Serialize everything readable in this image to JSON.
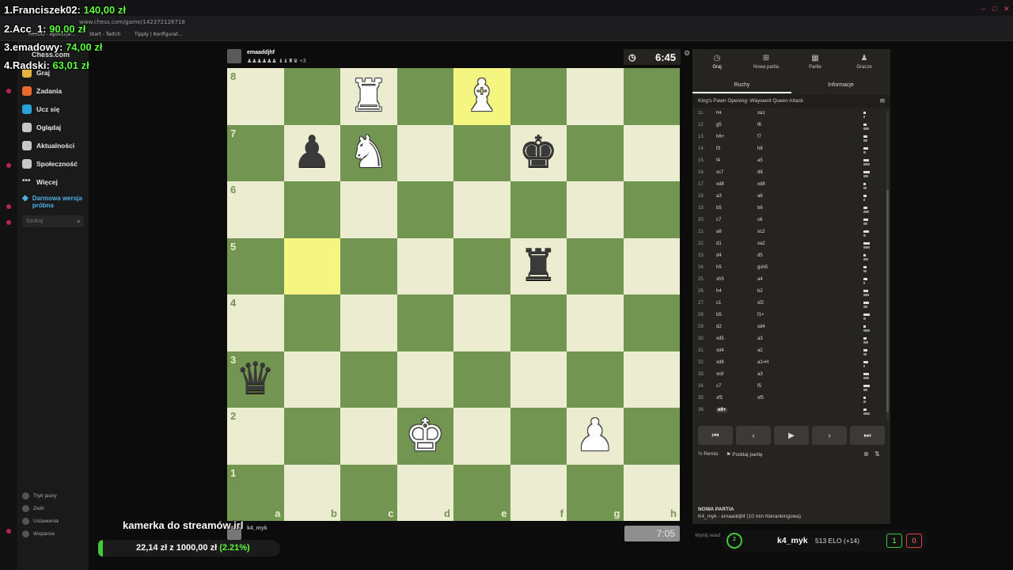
{
  "browser": {
    "url": "www.chess.com/game/142372126718",
    "bookmarks": [
      "RevDO - Aplikacje...",
      "Start - Twitch",
      "Tipply | Konfigurat..."
    ]
  },
  "leaderboard": [
    {
      "rank_name": "1.Franciszek02:",
      "amount": "140,00 zł"
    },
    {
      "rank_name": "2.Acc_1:",
      "amount": "90,00 zł"
    },
    {
      "rank_name": "3.emadowy:",
      "amount": "74,00 zł"
    },
    {
      "rank_name": "4.Radski:",
      "amount": "63,01 zł"
    }
  ],
  "sidebar": {
    "logo": "Chess.com",
    "items": [
      {
        "label": "Graj",
        "icon": "pawn-icon",
        "color": "#e2b23a"
      },
      {
        "label": "Zadania",
        "icon": "puzzle-icon",
        "color": "#e96a2a"
      },
      {
        "label": "Ucz się",
        "icon": "lessons-icon",
        "color": "#2aa1d8"
      },
      {
        "label": "Oglądaj",
        "icon": "binoculars-icon",
        "color": "#c7c7c7"
      },
      {
        "label": "Aktualności",
        "icon": "news-icon",
        "color": "#c7c7c7"
      },
      {
        "label": "Społeczność",
        "icon": "community-icon",
        "color": "#c7c7c7"
      },
      {
        "label": "Więcej",
        "icon": "more-icon",
        "color": "#c7c7c7"
      }
    ],
    "promo": "Darmowa wersja próbna",
    "search_placeholder": "Szukaj",
    "bottom": [
      "Tryb jasny",
      "Zwiń",
      "Ustawienia",
      "Wsparcie"
    ]
  },
  "game": {
    "top_player": "emaaddjhf",
    "top_captured": "+3",
    "bottom_player": "k4_myk",
    "top_clock": "6:45",
    "bottom_clock": "7:05",
    "ranks": [
      "8",
      "7",
      "6",
      "5",
      "4",
      "3",
      "2",
      "1"
    ],
    "files": [
      "a",
      "b",
      "c",
      "d",
      "e",
      "f",
      "g",
      "h"
    ],
    "pieces": [
      {
        "square": "c8",
        "glyph": "♜",
        "side": "white",
        "name": "white-rook"
      },
      {
        "square": "e8",
        "glyph": "♝",
        "side": "white",
        "name": "white-bishop"
      },
      {
        "square": "b7",
        "glyph": "♟",
        "side": "black",
        "name": "black-pawn"
      },
      {
        "square": "c7",
        "glyph": "♞",
        "side": "white",
        "name": "white-knight"
      },
      {
        "square": "f7",
        "glyph": "♚",
        "side": "black",
        "name": "black-king"
      },
      {
        "square": "f5",
        "glyph": "♜",
        "side": "black",
        "name": "black-rook"
      },
      {
        "square": "a3",
        "glyph": "♛",
        "side": "black",
        "name": "black-queen"
      },
      {
        "square": "d2",
        "glyph": "♚",
        "side": "white",
        "name": "white-king"
      },
      {
        "square": "g2",
        "glyph": "♟",
        "side": "white",
        "name": "white-pawn"
      }
    ],
    "highlighted": [
      "e8",
      "b5"
    ]
  },
  "panel": {
    "tabs": [
      {
        "label": "Graj",
        "icon": "clock-icon"
      },
      {
        "label": "Nowa partia",
        "icon": "plus-icon"
      },
      {
        "label": "Partie",
        "icon": "grid-icon"
      },
      {
        "label": "Gracze",
        "icon": "players-icon"
      }
    ],
    "subtabs": [
      "Ruchy",
      "Informacje"
    ],
    "opening": "King's Pawn Opening: Wayward Queen Attack",
    "moves": [
      {
        "n": "11.",
        "w": "h4",
        "b": "xa1"
      },
      {
        "n": "12.",
        "w": "g5",
        "b": "f6"
      },
      {
        "n": "13.",
        "w": "h6+",
        "b": "f7"
      },
      {
        "n": "14.",
        "w": "f3",
        "b": "h8"
      },
      {
        "n": "15.",
        "w": "f4",
        "b": "a5"
      },
      {
        "n": "16.",
        "w": "xc7",
        "b": "d8"
      },
      {
        "n": "17.",
        "w": "xd8",
        "b": "xd8"
      },
      {
        "n": "18.",
        "w": "a3",
        "b": "a6"
      },
      {
        "n": "19.",
        "w": "b5",
        "b": "b6"
      },
      {
        "n": "20.",
        "w": "c7",
        "b": "c6"
      },
      {
        "n": "21.",
        "w": "a8",
        "b": "xc2"
      },
      {
        "n": "22.",
        "w": "d1",
        "b": "xa2"
      },
      {
        "n": "23.",
        "w": "d4",
        "b": "d5"
      },
      {
        "n": "24.",
        "w": "h5",
        "b": "gxh5"
      },
      {
        "n": "25.",
        "w": "xh5",
        "b": "a4"
      },
      {
        "n": "26.",
        "w": "h4",
        "b": "b2"
      },
      {
        "n": "27.",
        "w": "c1",
        "b": "xf2"
      },
      {
        "n": "28.",
        "w": "b5",
        "b": "f1+"
      },
      {
        "n": "29.",
        "w": "d2",
        "b": "xd4"
      },
      {
        "n": "30.",
        "w": "xd5",
        "b": "a3"
      },
      {
        "n": "31.",
        "w": "xd4",
        "b": "a2"
      },
      {
        "n": "32.",
        "w": "xd8",
        "b": "a1=H"
      },
      {
        "n": "33.",
        "w": "xc8",
        "b": "a3"
      },
      {
        "n": "34.",
        "w": "c7",
        "b": "f5"
      },
      {
        "n": "35.",
        "w": "xf5",
        "b": "xf5"
      },
      {
        "n": "36.",
        "w": "e8+",
        "b": ""
      }
    ],
    "actions": [
      "Remis",
      "Poddaj partię"
    ],
    "new_game_title": "NOWA PARTIA",
    "new_game_desc": "K4_myk - emaaddjhf (10 min Nierankingowa)",
    "send_placeholder": "Wyślij wiad"
  },
  "stream": {
    "cam_text": "kamerka do streamów irl",
    "goal_current": "22,14 zł",
    "goal_sep": "z",
    "goal_target": "1000,00 zł",
    "goal_pct": "(2.21%)",
    "goal_fraction": 0.0221,
    "score_name": "k4_myk",
    "score_elo": "513 ELO (+14)",
    "wins": "1",
    "losses": "0",
    "ring": "2"
  }
}
